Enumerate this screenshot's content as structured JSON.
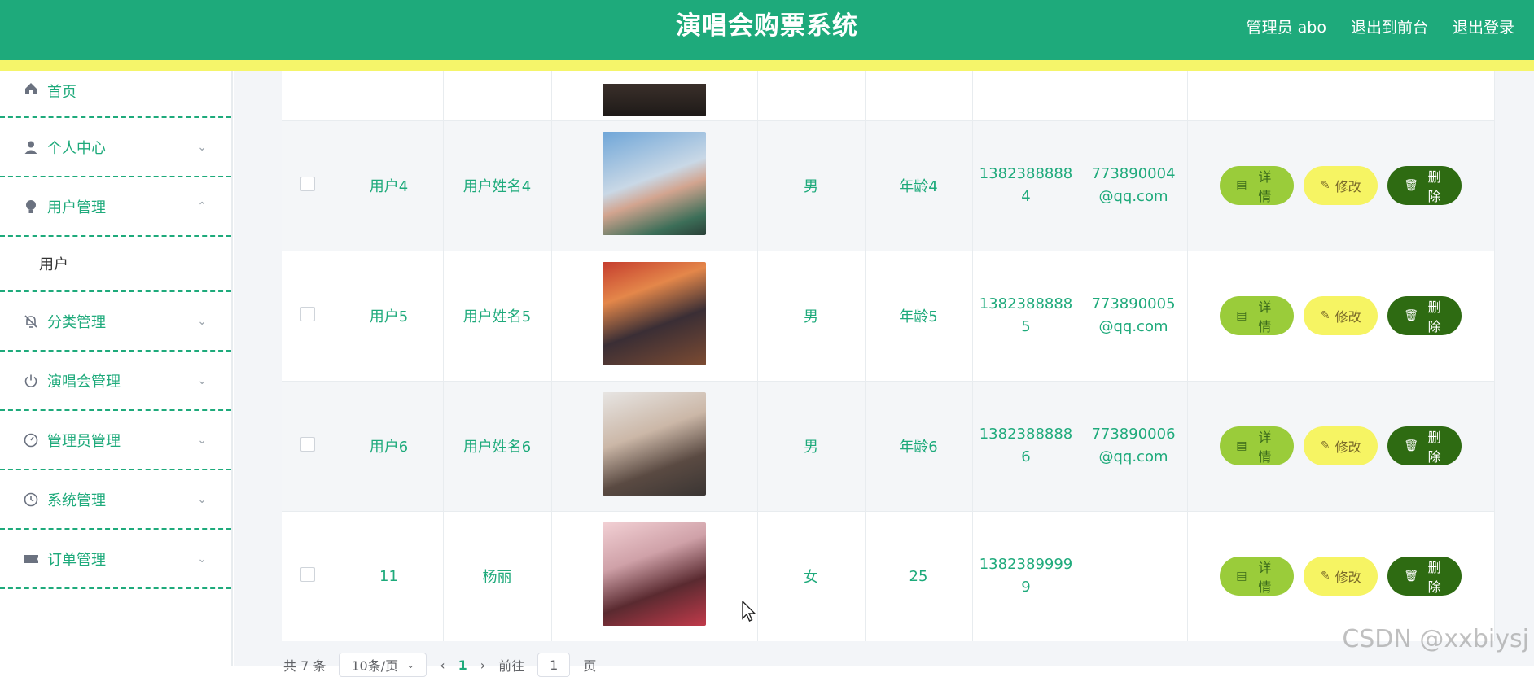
{
  "header": {
    "title": "演唱会购票系统",
    "links": [
      "管理员 abo",
      "退出到前台",
      "退出登录"
    ]
  },
  "sidebar": {
    "items": [
      {
        "label": "首页",
        "icon": "home-icon"
      },
      {
        "label": "个人中心",
        "icon": "user-icon"
      },
      {
        "label": "用户管理",
        "icon": "bulb-icon",
        "expanded": true
      },
      {
        "label": "分类管理",
        "icon": "bell-off-icon"
      },
      {
        "label": "演唱会管理",
        "icon": "power-icon"
      },
      {
        "label": "管理员管理",
        "icon": "gauge-icon"
      },
      {
        "label": "系统管理",
        "icon": "clock-icon"
      },
      {
        "label": "订单管理",
        "icon": "ticket-icon"
      }
    ],
    "submenu": {
      "label": "用户"
    }
  },
  "table": {
    "rows": [
      {
        "account": "用户4",
        "name": "用户姓名4",
        "gender": "男",
        "age": "年龄4",
        "phone": [
          "1382388888",
          "4"
        ],
        "email": [
          "773890004",
          "@qq.com"
        ]
      },
      {
        "account": "用户5",
        "name": "用户姓名5",
        "gender": "男",
        "age": "年龄5",
        "phone": [
          "1382388888",
          "5"
        ],
        "email": [
          "773890005",
          "@qq.com"
        ]
      },
      {
        "account": "用户6",
        "name": "用户姓名6",
        "gender": "男",
        "age": "年龄6",
        "phone": [
          "1382388888",
          "6"
        ],
        "email": [
          "773890006",
          "@qq.com"
        ]
      },
      {
        "account": "11",
        "name": "杨丽",
        "gender": "女",
        "age": "25",
        "phone": [
          "1382389999",
          "9"
        ],
        "email": [
          "",
          ""
        ]
      }
    ],
    "actions": {
      "detail": "详情",
      "edit": "修改",
      "delete": "删除"
    }
  },
  "pager": {
    "total": "共 7 条",
    "page_size": "10条/页",
    "current": "1",
    "goto_label": "前往",
    "goto_value": "1",
    "page_suffix": "页"
  },
  "watermark": "CSDN @xxbiysj",
  "colors": {
    "primary": "#1eaa7b",
    "accent_yellow": "#f5f56a",
    "detail_btn": "#9acc3a",
    "edit_btn": "#f6f463",
    "delete_btn": "#2e6b12"
  }
}
